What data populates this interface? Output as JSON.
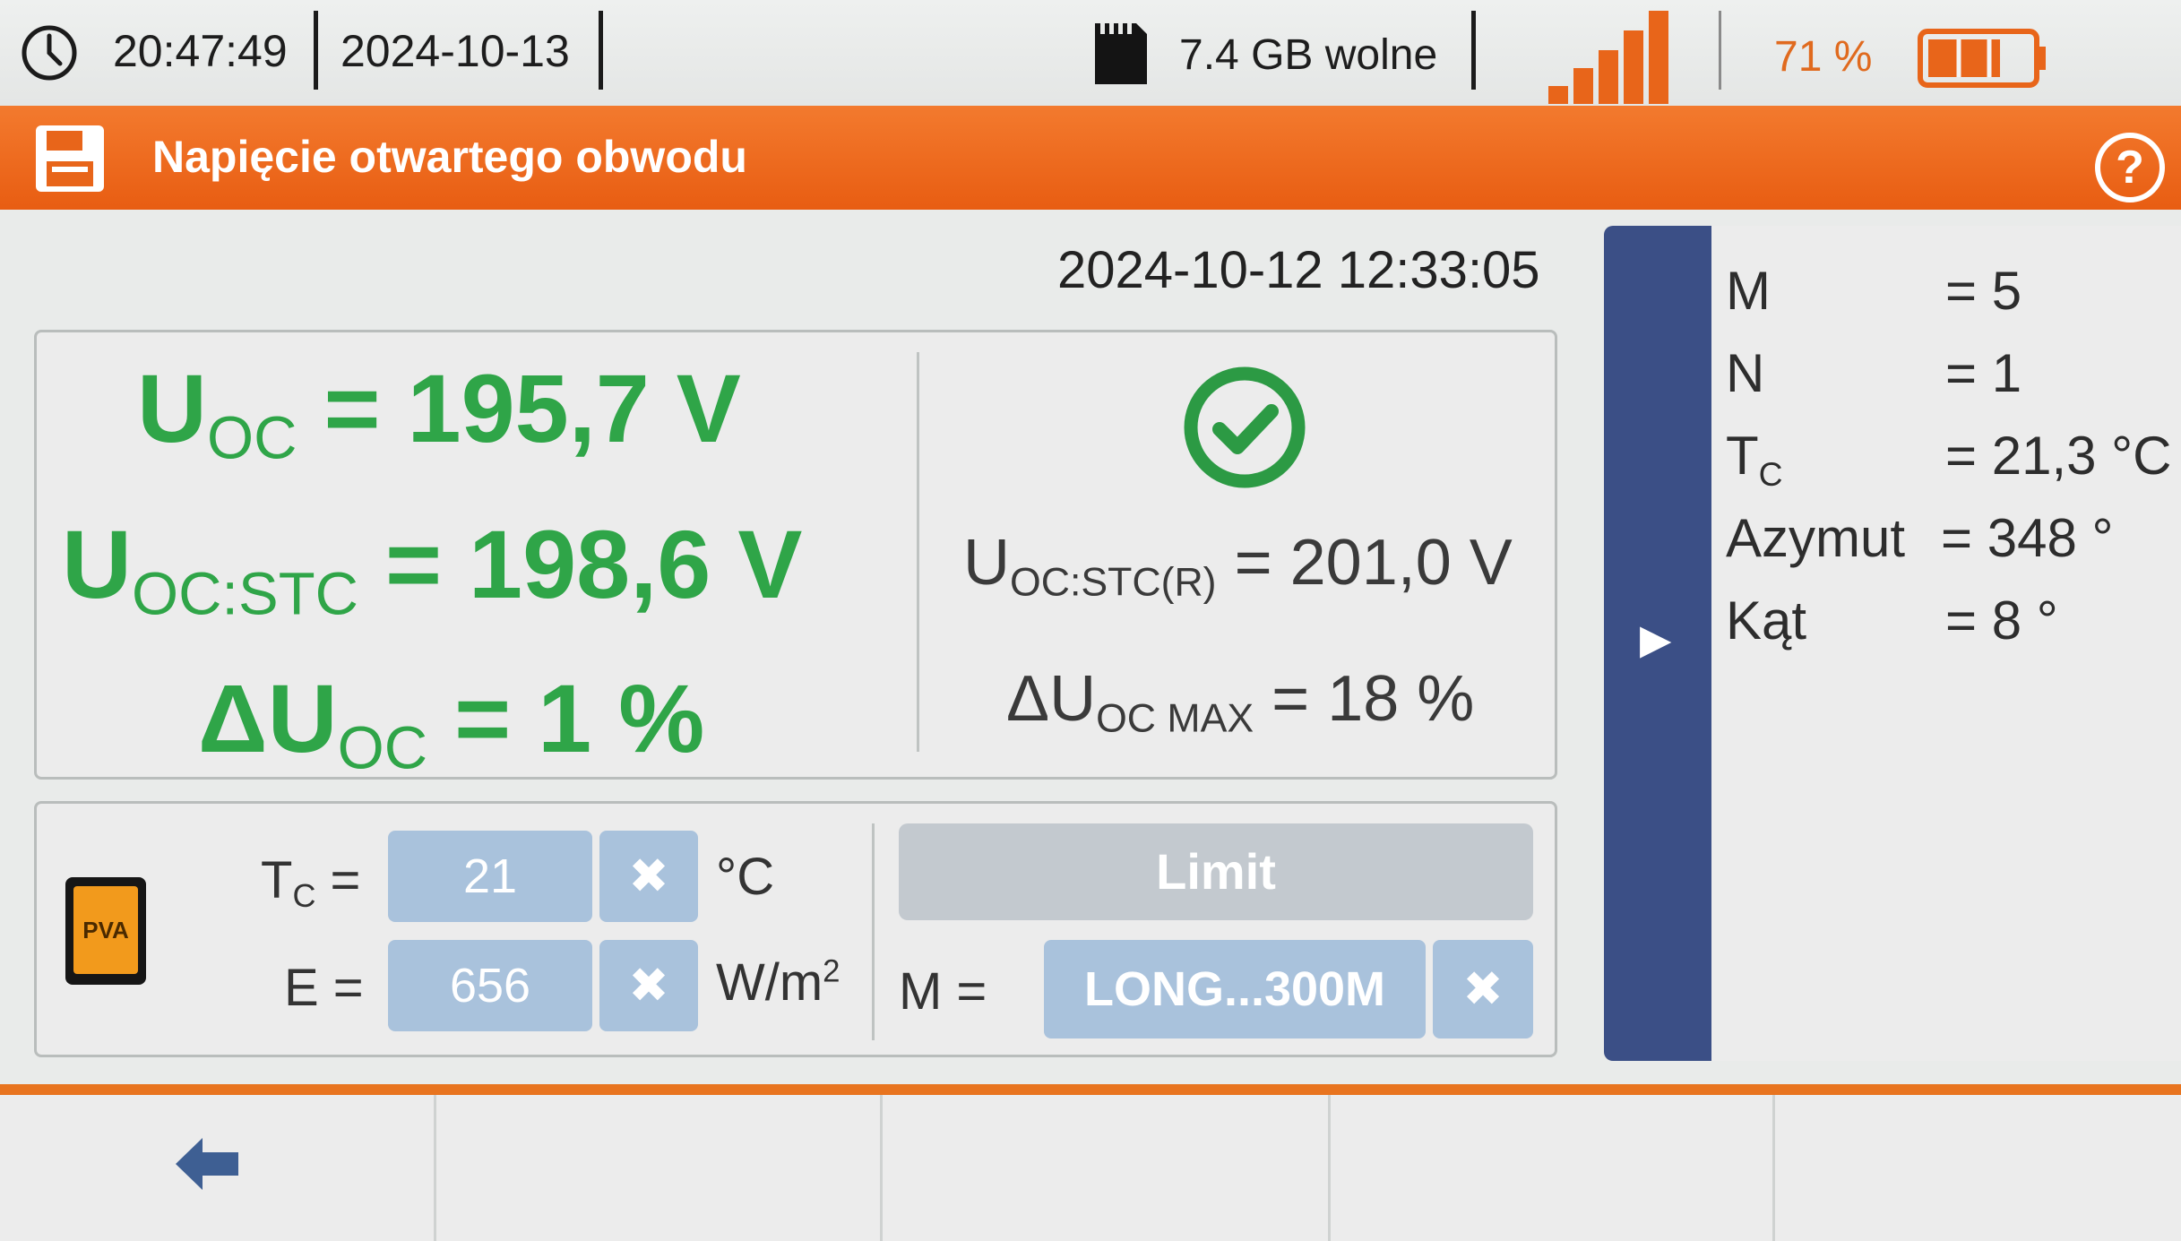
{
  "status_bar": {
    "time": "20:47:49",
    "date": "2024-10-13",
    "storage": "7.4 GB wolne",
    "battery_percent": "71 %",
    "battery_level": 0.71,
    "signal_bars": 5,
    "icons": [
      "clock-icon",
      "sd-card-icon",
      "signal-icon",
      "battery-icon"
    ]
  },
  "title_bar": {
    "title": "Napięcie otwartego obwodu",
    "icons": [
      "save-icon",
      "help-icon"
    ],
    "help_glyph": "?"
  },
  "measurement": {
    "timestamp": "2024-10-12 12:33:05",
    "uoc_label": "U",
    "uoc_sub": "OC",
    "uoc_value": "= 195,7 V",
    "uocstc_label": "U",
    "uocstc_sub": "OC:STC",
    "uocstc_value": "= 198,6 V",
    "duoc_label": "ΔU",
    "duoc_sub": "OC",
    "duoc_value": "= 1 %",
    "ref_label": "U",
    "ref_sub": "OC:STC(R)",
    "ref_value": "= 201,0 V",
    "max_label": "ΔU",
    "max_sub": "OC MAX",
    "max_value": "= 18 %",
    "result_icon": "check-circle-icon",
    "accent_color": "#2fa548"
  },
  "settings": {
    "module_badge": "PVA",
    "tc_label": "T",
    "tc_sub": "C",
    "tc_eq": "=",
    "tc_value": "21",
    "tc_unit": "°C",
    "e_label": "E =",
    "e_value": "656",
    "e_unit": "W/m",
    "e_unit_sup": "2",
    "clear_glyph": "✖",
    "limit_label": "Limit",
    "m_label": "M =",
    "m_value": "LONG...300M"
  },
  "side_panel": {
    "expand_glyph": "▶",
    "params": [
      {
        "name": "M",
        "sub": "",
        "value": "= 5"
      },
      {
        "name": "N",
        "sub": "",
        "value": "= 1"
      },
      {
        "name": "T",
        "sub": "C",
        "value": "= 21,3 °C"
      },
      {
        "name": "Azymut",
        "sub": "",
        "value": "= 348 °"
      },
      {
        "name": "Kąt",
        "sub": "",
        "value": "= 8 °"
      }
    ]
  },
  "toolbar": {
    "back_icon": "back-arrow-icon"
  },
  "colors": {
    "header_orange": "#ec661a",
    "field_blue": "#a9c2dc",
    "side_bar_navy": "#3b4f86"
  }
}
